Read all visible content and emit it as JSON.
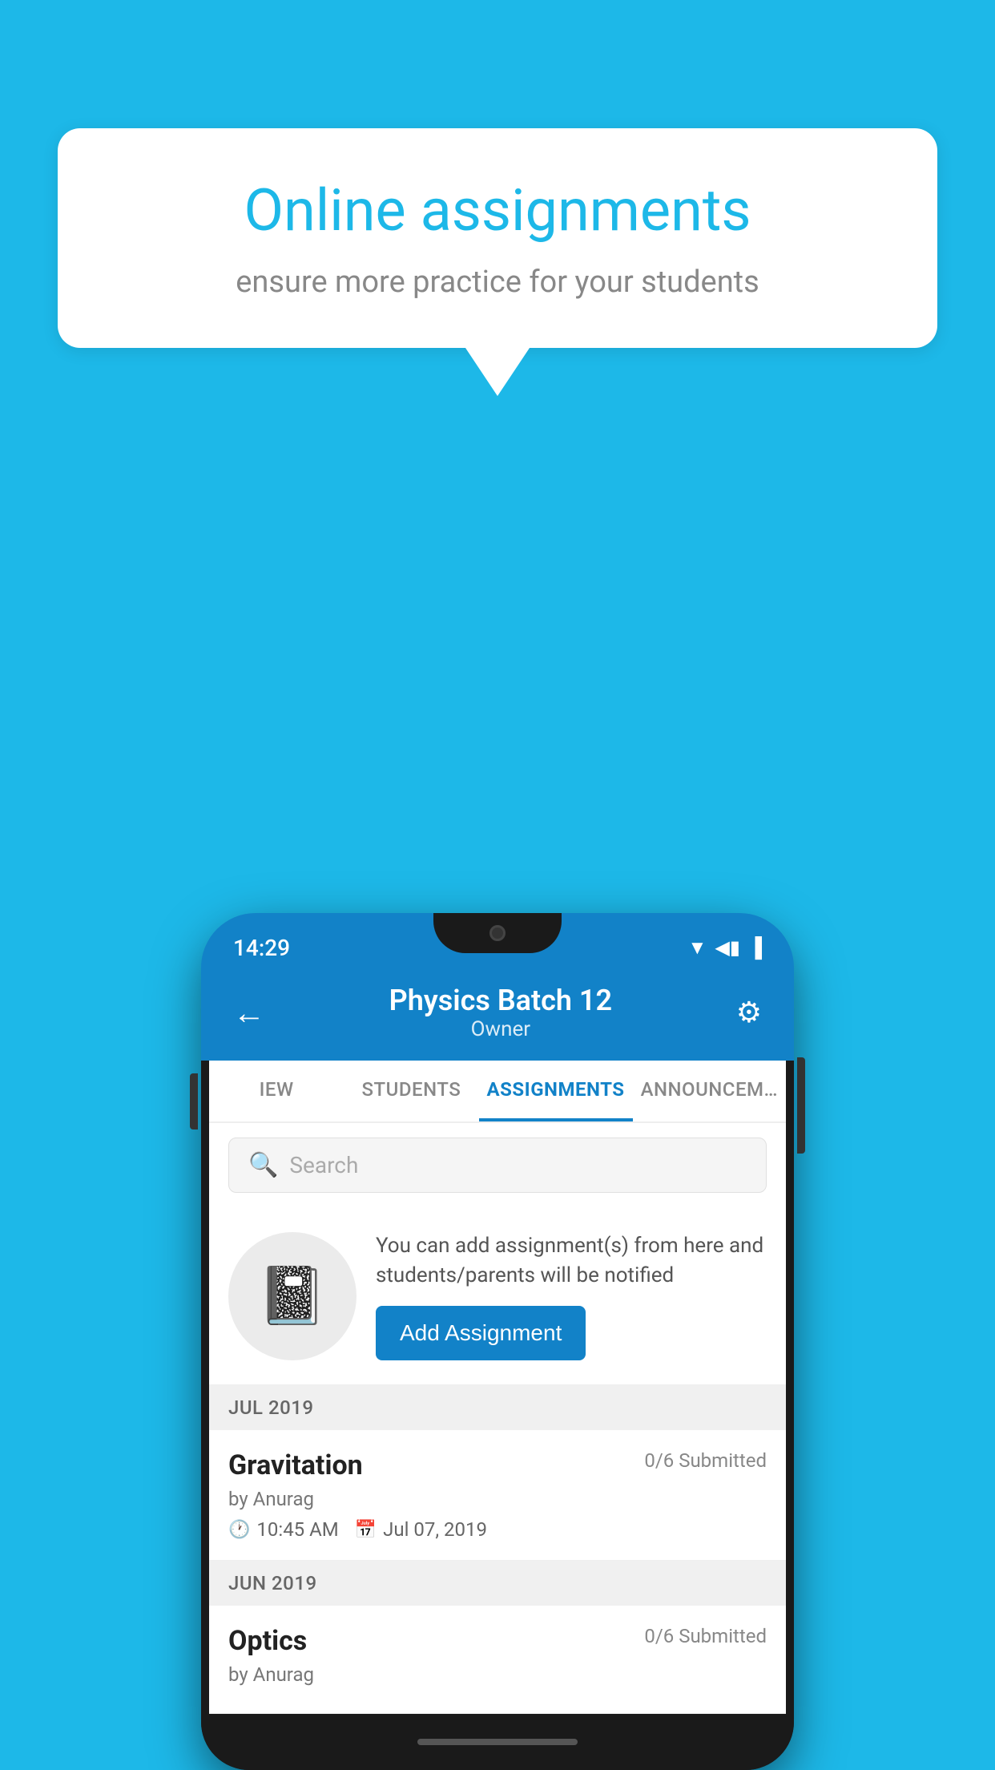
{
  "background_color": "#1db8e8",
  "speech_bubble": {
    "title": "Online assignments",
    "subtitle": "ensure more practice for your students"
  },
  "phone": {
    "status_bar": {
      "time": "14:29",
      "icons": "▼◀▐"
    },
    "header": {
      "title": "Physics Batch 12",
      "subtitle": "Owner",
      "back_label": "←",
      "settings_label": "⚙"
    },
    "tabs": [
      {
        "label": "IEW",
        "active": false
      },
      {
        "label": "STUDENTS",
        "active": false
      },
      {
        "label": "ASSIGNMENTS",
        "active": true
      },
      {
        "label": "ANNOUNCEM…",
        "active": false
      }
    ],
    "search": {
      "placeholder": "Search"
    },
    "add_assignment_section": {
      "promo_text": "You can add assignment(s) from here and students/parents will be notified",
      "button_label": "Add Assignment"
    },
    "months": [
      {
        "label": "JUL 2019",
        "assignments": [
          {
            "name": "Gravitation",
            "submitted": "0/6 Submitted",
            "by": "by Anurag",
            "time": "10:45 AM",
            "date": "Jul 07, 2019"
          }
        ]
      },
      {
        "label": "JUN 2019",
        "assignments": [
          {
            "name": "Optics",
            "submitted": "0/6 Submitted",
            "by": "by Anurag",
            "time": "",
            "date": ""
          }
        ]
      }
    ]
  }
}
